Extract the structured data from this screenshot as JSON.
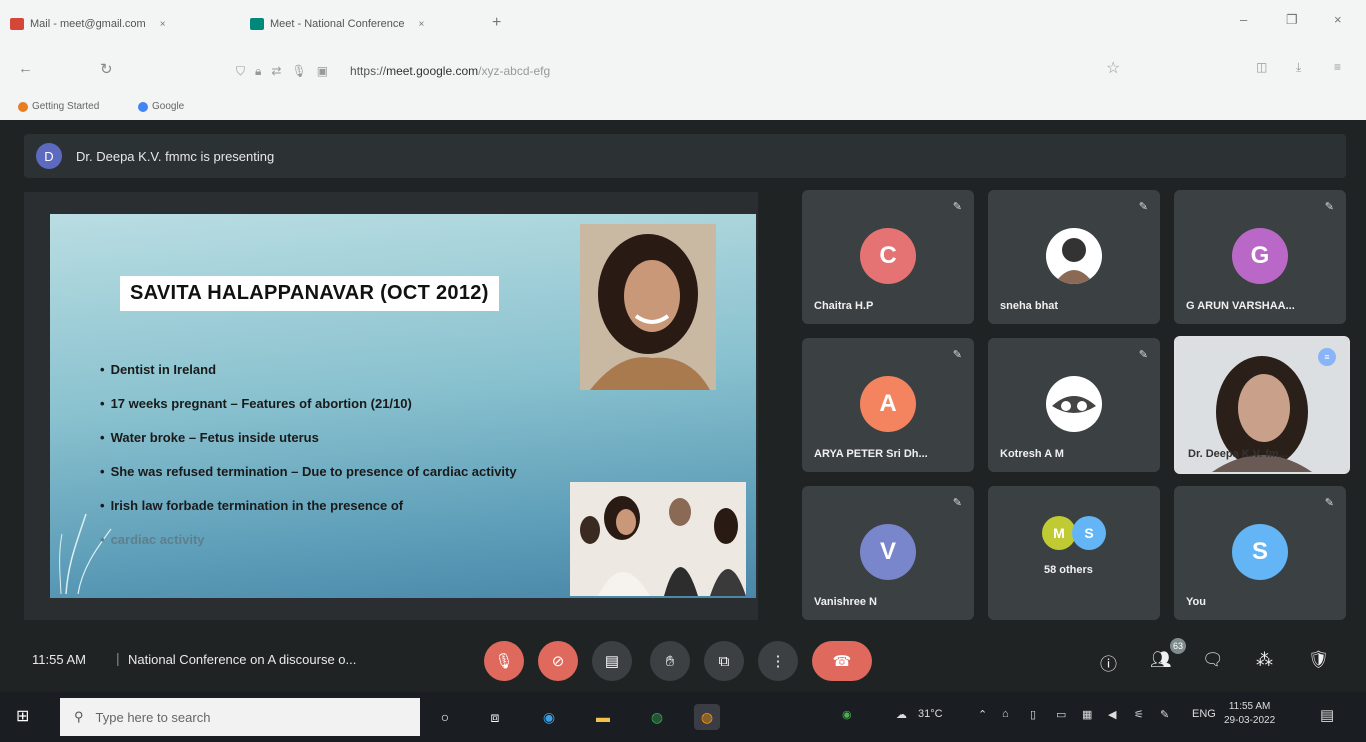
{
  "browser": {
    "tabs": [
      {
        "label": "Mail - meet@gmail.com",
        "close": "×"
      },
      {
        "label": "Meet - National Conference",
        "close": "×"
      }
    ],
    "new_tab": "+",
    "window_controls": {
      "minimize": "–",
      "restore": "❐",
      "close": "×"
    },
    "nav": {
      "back": "←",
      "reload": "↻"
    },
    "url": {
      "prefix": "https://",
      "domain": "meet.google.com",
      "path": "/xyz-abcd-efg"
    },
    "bookmarks": [
      {
        "label": "Getting Started",
        "color": "#e67e22"
      },
      {
        "label": "Google",
        "color": "#4285f4"
      }
    ]
  },
  "meet": {
    "presenter_initial": "D",
    "presenting_text": "Dr. Deepa K.V. fmmc is presenting",
    "slide": {
      "title": "SAVITA HALAPPANAVAR (OCT 2012)",
      "bullets": [
        "Dentist in Ireland",
        "17 weeks pregnant – Features of abortion (21/10)",
        "Water broke – Fetus inside uterus",
        "She was refused termination – Due to presence of cardiac activity",
        "Irish law forbade termination in the presence of",
        "cardiac activity"
      ]
    },
    "participants": [
      {
        "name": "Chaitra H.P",
        "initial": "C",
        "color": "#e57373"
      },
      {
        "name": "sneha bhat",
        "initial": "",
        "color": "#ffffff"
      },
      {
        "name": "G ARUN VARSHAA...",
        "initial": "G",
        "color": "#ba68c8"
      },
      {
        "name": "ARYA PETER Sri Dh...",
        "initial": "A",
        "color": "#f4845f"
      },
      {
        "name": "Kotresh A M",
        "initial": "",
        "color": "#ffffff"
      },
      {
        "name": "Dr. Deepa K.V. fm...",
        "initial": "",
        "color": "#e0e0e0"
      },
      {
        "name": "Vanishree N",
        "initial": "V",
        "color": "#7986cb"
      },
      {
        "name": "58 others",
        "initial": "M",
        "initial2": "S",
        "color": "#c0ca33",
        "color2": "#64b5f6"
      },
      {
        "name": "You",
        "initial": "S",
        "color": "#64b5f6"
      }
    ],
    "mic_off_icon": "🎤",
    "bottom": {
      "time": "11:55 AM",
      "separator": "|",
      "meeting_title": "National Conference on A discourse o...",
      "people_count": "63"
    }
  },
  "taskbar": {
    "search_placeholder": "Type here to search",
    "weather": "31°C",
    "lang": "ENG",
    "time": "11:55 AM",
    "date": "29-03-2022"
  },
  "colors": {
    "end_call": "#e0695d",
    "meet_bg": "#1f2324",
    "tile_bg": "#3b4042"
  }
}
